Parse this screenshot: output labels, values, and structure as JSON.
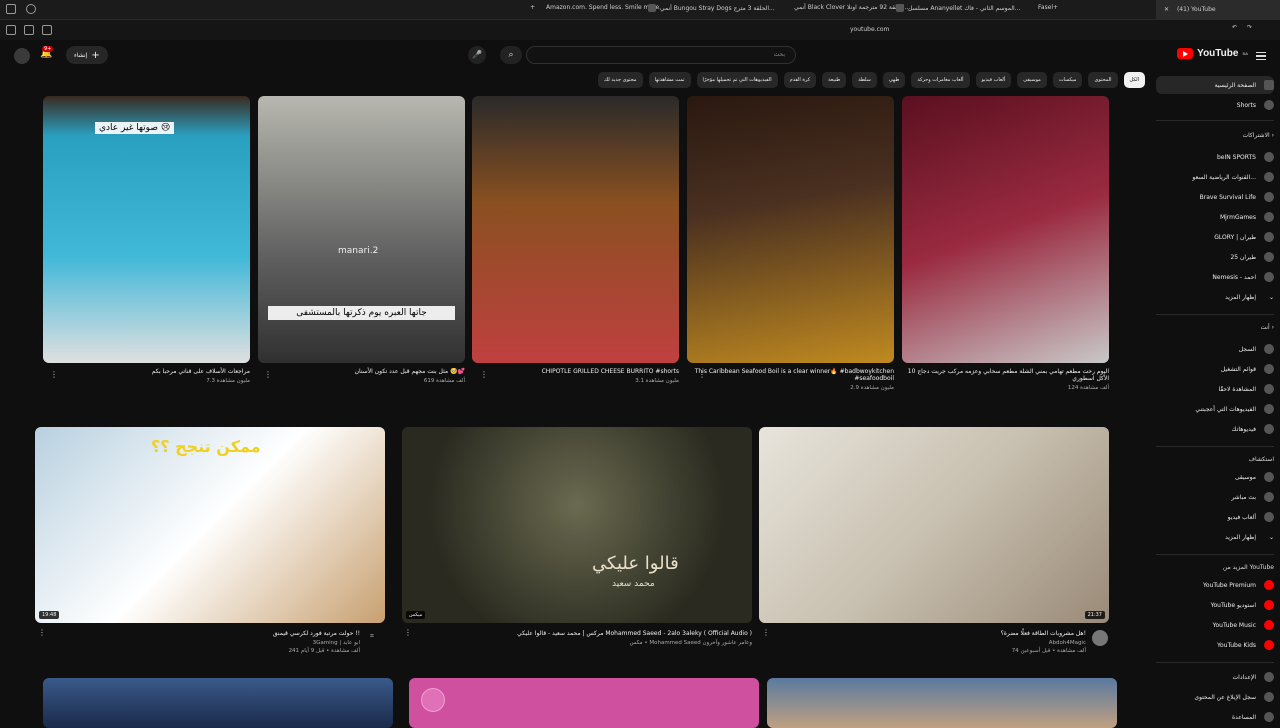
{
  "browser": {
    "tabs": [
      "Amazon.com. Spend less. Smile more.",
      "أنمي Bungou Stray Dogs الحلقة 3 مترج...",
      "أنمي Black Clover الحلقة 92 مترجمة اونلا...",
      "مسلسل Ananyellet الموسم الثاني - فاك...",
      "Fasel+"
    ],
    "active_tab": "(41) YouTube",
    "url": "youtube.com"
  },
  "header": {
    "logo": "YouTube",
    "logo_region": "SA",
    "search_placeholder": "بحث",
    "create_label": "إنشاء",
    "notif_count": "9+"
  },
  "chips": [
    "الكل",
    "المحتوى",
    "ميكسات",
    "موسيقى",
    "ألعاب فيديو",
    "ألعاب مغامرات وحركة",
    "طهي",
    "سلطة",
    "طبيعة",
    "كرة القدم",
    "الفيديوهات التي تم تحميلها مؤخرًا",
    "تمت مشاهدتها",
    "محتوى جديد لك"
  ],
  "sidebar": {
    "home": "الصفحة الرئيسية",
    "shorts": "Shorts",
    "subs_head": "الاشتراكات",
    "subs": [
      "beIN SPORTS",
      "القنوات الرياضية السعو...",
      "Brave Survival Life",
      "MjrmGames",
      "GLORY | طيران",
      "طيران 25",
      "Nemesis - احمد",
      "إظهار المزيد"
    ],
    "you_head": "أنت",
    "you": [
      "السجل",
      "قوائم التشغيل",
      "المشاهدة لاحقًا",
      "الفيديوهات التي أعجبتني",
      "فيديوهاتك"
    ],
    "explore_head": "استكشاف",
    "explore": [
      "موسيقى",
      "بث مباشر",
      "ألعاب فيديو",
      "إظهار المزيد"
    ],
    "more_head": "المزيد من YouTube",
    "more": [
      "YouTube Premium",
      "YouTube استوديو",
      "YouTube Music",
      "YouTube Kids"
    ],
    "bottom": [
      "الإعدادات",
      "سجل الإبلاغ عن المحتوى",
      "المساعدة"
    ]
  },
  "shorts": [
    {
      "title": "اليوم رحت مطعم تهامي بمني الشلة مطعم سحابي وعزمه مركب جريت دجاج 10 الأكل اسطوري",
      "views": "124 ألف مشاهدة"
    },
    {
      "title": "This Caribbean Seafood Boil is a clear winner🔥 #badbwoykitchen #seafoodboil",
      "views": "2.9 مليون مشاهدة"
    },
    {
      "title": "CHIPOTLE GRILLED CHEESE BURRITO #shorts",
      "views": "3.1 مليون مشاهدة"
    },
    {
      "title": "مثل بنت مجهم قبل عدد تكون الأسنان 🥺💕",
      "views": "619 ألف مشاهدة",
      "overlay": "جاتها العبره يوم ذكرتها بالمستشفى",
      "watermark": "manari.2"
    },
    {
      "title": "مراجعات الأسلاف على قناتي مرحبا بكم",
      "views": "7.3 مليون مشاهدة",
      "overlay": "صوتها غير عادي 😢"
    }
  ],
  "videos": [
    {
      "title": "هل مشروبات الطاقة فعلًا مضرة؟!",
      "channel": "Abdoh4Magic",
      "stats": "74 ألف مشاهدة • قبل أسبوعين",
      "duration": "21:37"
    },
    {
      "title": "مركس | محمد سعيد - قالوا عليكي Mohammed Saeed - 2alo 3aleky ( Official Audio )",
      "channel": "مكس • Mohammed Saeed وعامر عاشور وآخرون",
      "stats": "",
      "duration": "ميكس",
      "overlay": "قالوا عليكي",
      "overlay_sub": "محمد سعيد"
    },
    {
      "title": "حولت مرتبة فورد لكرسي قيمنق !!",
      "channel": "3Gaming | ابو عابد",
      "stats": "241 ألف مشاهدة • قبل 9 أيام",
      "duration": "19:48",
      "overlay": "ممكن تنجح ؟؟"
    }
  ]
}
